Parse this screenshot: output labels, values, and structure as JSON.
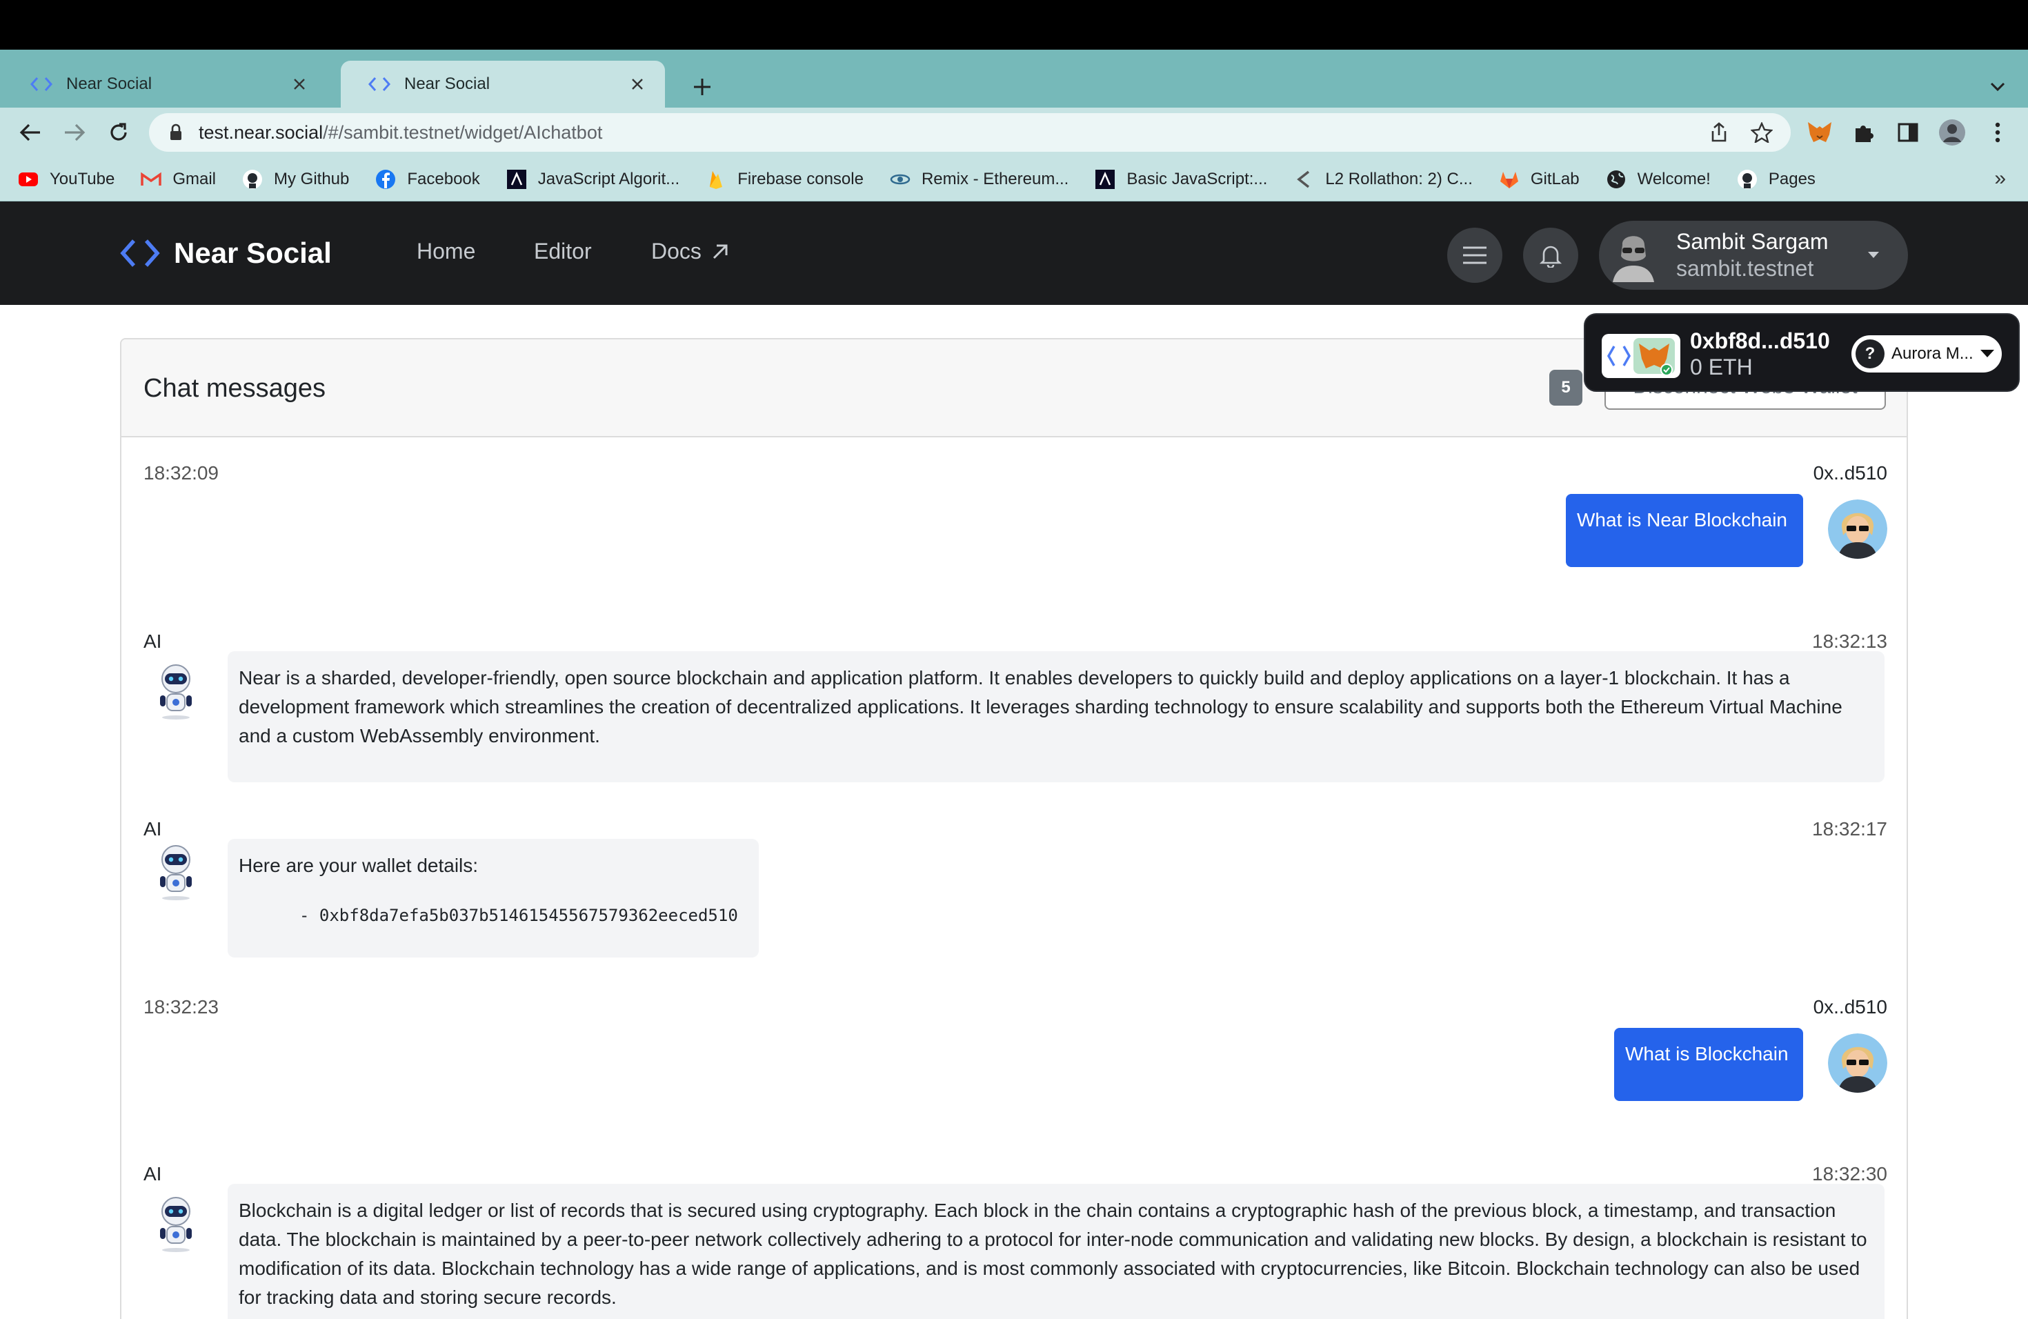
{
  "browser": {
    "tabs": [
      {
        "title": "Near Social",
        "active": false
      },
      {
        "title": "Near Social",
        "active": true
      }
    ],
    "address": {
      "host": "test.near.social",
      "path": "/#/sambit.testnet/widget/AIchatbot"
    },
    "bookmarks": [
      {
        "label": "YouTube",
        "icon": "youtube-icon",
        "color": "#ff0000"
      },
      {
        "label": "Gmail",
        "icon": "gmail-icon",
        "color": "#ea4335"
      },
      {
        "label": "My Github",
        "icon": "github-icon",
        "color": "#24292f"
      },
      {
        "label": "Facebook",
        "icon": "facebook-icon",
        "color": "#1877f2"
      },
      {
        "label": "JavaScript Algorit...",
        "icon": "freecodecamp-icon",
        "color": "#0a0a23"
      },
      {
        "label": "Firebase console",
        "icon": "firebase-icon",
        "color": "#ffca28"
      },
      {
        "label": "Remix - Ethereum...",
        "icon": "remix-icon",
        "color": "#2f6a8f"
      },
      {
        "label": "Basic JavaScript:...",
        "icon": "freecodecamp-icon",
        "color": "#0a0a23"
      },
      {
        "label": "L2 Rollathon: 2) C...",
        "icon": "rollathon-icon",
        "color": "#555555"
      },
      {
        "label": "GitLab",
        "icon": "gitlab-icon",
        "color": "#fc6d26"
      },
      {
        "label": "Welcome!",
        "icon": "globe-icon",
        "color": "#202124"
      },
      {
        "label": "Pages",
        "icon": "github-icon",
        "color": "#24292f"
      }
    ],
    "bookmarks_more": "»"
  },
  "app": {
    "brand": "Near Social",
    "nav": [
      {
        "label": "Home"
      },
      {
        "label": "Editor"
      },
      {
        "label": "Docs"
      }
    ],
    "profile": {
      "name": "Sambit Sargam",
      "account": "sambit.testnet"
    }
  },
  "wallet": {
    "address": "0xbf8d...d510",
    "balance": "0 ETH",
    "network": "Aurora M..."
  },
  "chat": {
    "title": "Chat messages",
    "badge": "5",
    "disconnect_label": "Disconnect Web3 Wallet",
    "messages": [
      {
        "from": "user",
        "time": "18:32:09",
        "sender": "0x..d510",
        "text": "What is Near Blockchain"
      },
      {
        "from": "ai",
        "time": "18:32:13",
        "sender": "AI",
        "text": "Near is a sharded, developer-friendly, open source blockchain and application platform. It enables developers to quickly build and deploy applications on a layer-1 blockchain. It has a development framework which streamlines the creation of decentralized applications. It leverages sharding technology to ensure scalability and supports both the Ethereum Virtual Machine and a custom WebAssembly environment."
      },
      {
        "from": "ai",
        "time": "18:32:17",
        "sender": "AI",
        "text": "Here are your wallet details:",
        "code": "- 0xbf8da7efa5b037b51461545567579362eeced510"
      },
      {
        "from": "user",
        "time": "18:32:23",
        "sender": "0x..d510",
        "text": "What is Blockchain"
      },
      {
        "from": "ai",
        "time": "18:32:30",
        "sender": "AI",
        "text": "Blockchain is a digital ledger or list of records that is secured using cryptography. Each block in the chain contains a cryptographic hash of the previous block, a timestamp, and transaction data. The blockchain is maintained by a peer-to-peer network collectively adhering to a protocol for inter-node communication and validating new blocks. By design, a blockchain is resistant to modification of its data. Blockchain technology has a wide range of applications, and is most commonly associated with cryptocurrencies, like Bitcoin. Blockchain technology can also be used for tracking data and storing secure records."
      }
    ]
  },
  "colors": {
    "tabstrip": "#76b9b9",
    "toolbar": "#c6e3e3",
    "nav_bg": "#1b1c1e",
    "brand_blue": "#4d7cf4",
    "user_bubble": "#2563eb",
    "ai_bubble": "#f3f4f6"
  }
}
